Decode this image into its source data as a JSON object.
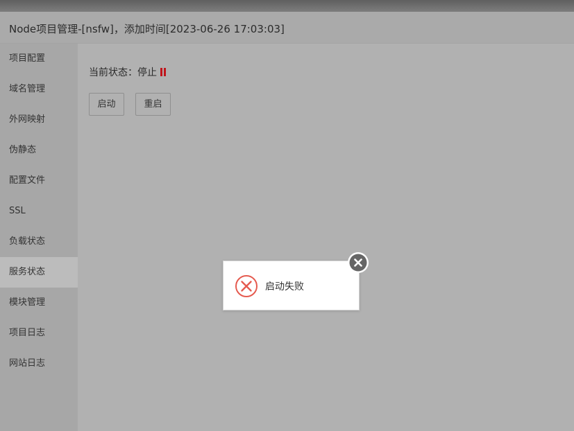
{
  "window": {
    "title": "Node项目管理-[nsfw]，添加时间[2023-06-26 17:03:03]"
  },
  "sidebar": {
    "active_index": 7,
    "items": [
      {
        "label": "项目配置"
      },
      {
        "label": "域名管理"
      },
      {
        "label": "外网映射"
      },
      {
        "label": "伪静态"
      },
      {
        "label": "配置文件"
      },
      {
        "label": "SSL"
      },
      {
        "label": "负载状态"
      },
      {
        "label": "服务状态"
      },
      {
        "label": "模块管理"
      },
      {
        "label": "项目日志"
      },
      {
        "label": "网站日志"
      }
    ]
  },
  "main": {
    "status_label": "当前状态：",
    "status_value": "停止",
    "status_icon": "pause-icon",
    "status_color": "#c0141b",
    "start_button": "启动",
    "restart_button": "重启"
  },
  "toast": {
    "message": "启动失败",
    "icon": "error-circle-x-icon",
    "icon_color": "#e55a4f",
    "close_icon": "close-icon"
  }
}
